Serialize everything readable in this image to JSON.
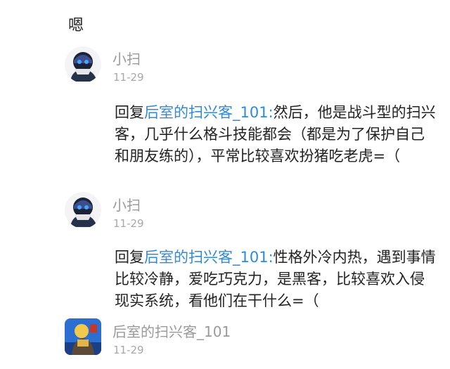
{
  "orphan_text": "嗯",
  "posts": [
    {
      "username": "小扫",
      "time": "11-29",
      "reply_prefix": "回复",
      "reply_to": "后室的扫兴客_101",
      "colon": ":",
      "message": "然后，他是战斗型的扫兴客，几乎什么格斗技能都会（都是为了保护自己和朋友练的），平常比较喜欢扮猪吃老虎=（"
    },
    {
      "username": "小扫",
      "time": "11-29",
      "reply_prefix": "回复",
      "reply_to": "后室的扫兴客_101",
      "colon": ":",
      "message": "性格外冷内热，遇到事情比较冷静，爱吃巧克力，是黑客，比较喜欢入侵现实系统，看他们在干什么=（"
    },
    {
      "username": "后室的扫兴客_101",
      "time": "11-29"
    }
  ],
  "colors": {
    "link": "#2f8ad8",
    "username": "#9a9a9a",
    "time": "#a8a8a8",
    "text": "#222222"
  }
}
